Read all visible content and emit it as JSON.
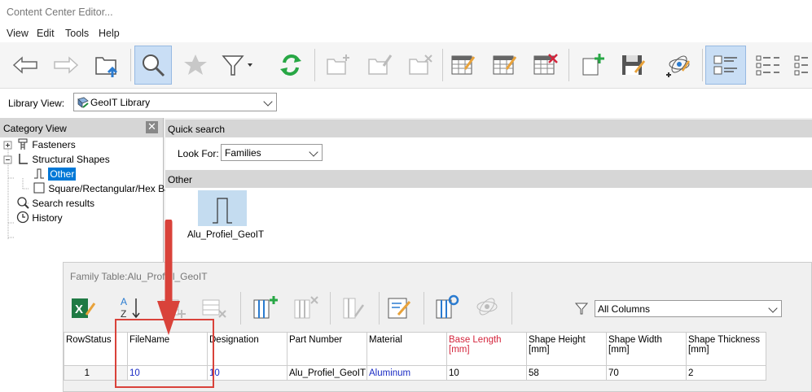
{
  "window": {
    "title": "Content Center Editor..."
  },
  "menu": [
    "View",
    "Edit",
    "Tools",
    "Help"
  ],
  "toolbar": {
    "icons": [
      "back-icon",
      "forward-icon",
      "open-folder-icon",
      "search-icon",
      "favorite-star-icon",
      "filter-icon",
      "refresh-icon",
      "new-category-icon",
      "edit-category-icon",
      "delete-category-icon",
      "edit-table-icon",
      "table-icon",
      "delete-table-icon",
      "add-family-icon",
      "save-icon",
      "publish-icon",
      "large-icons-view-icon",
      "list-view-icon",
      "details-view-icon"
    ]
  },
  "library": {
    "label": "Library View:",
    "value": "GeoIT Library"
  },
  "category": {
    "header": "Category View",
    "items": [
      {
        "label": "Fasteners"
      },
      {
        "label": "Structural Shapes"
      },
      {
        "label": "Other"
      },
      {
        "label": "Square/Rectangular/Hex Bar"
      },
      {
        "label": "Search results"
      },
      {
        "label": "History"
      }
    ]
  },
  "quick_search": {
    "header": "Quick search",
    "look_for_label": "Look For:",
    "look_for_value": "Families"
  },
  "other": {
    "header": "Other",
    "family_label": "Alu_Profiel_GeoIT"
  },
  "family_table": {
    "title": "Family Table:Alu_Profiel_GeoIT",
    "columns_filter": "All Columns",
    "columns": [
      {
        "label": "RowStatus",
        "unit": ""
      },
      {
        "label": "FileName",
        "unit": ""
      },
      {
        "label": "Designation",
        "unit": ""
      },
      {
        "label": "Part Number",
        "unit": ""
      },
      {
        "label": "Material",
        "unit": ""
      },
      {
        "label": "Base Length",
        "unit": "[mm]"
      },
      {
        "label": "Shape Height",
        "unit": "[mm]"
      },
      {
        "label": "Shape Width",
        "unit": "[mm]"
      },
      {
        "label": "Shape Thickness",
        "unit": "[mm]"
      }
    ],
    "rows": [
      [
        "1",
        "10",
        "10",
        "Alu_Profiel_GeoIT",
        "Aluminum",
        "10",
        "58",
        "70",
        "2"
      ]
    ]
  },
  "colors": {
    "highlight_box": "#d9423a",
    "selection": "#0078d7",
    "key_column": "#d4253c"
  }
}
